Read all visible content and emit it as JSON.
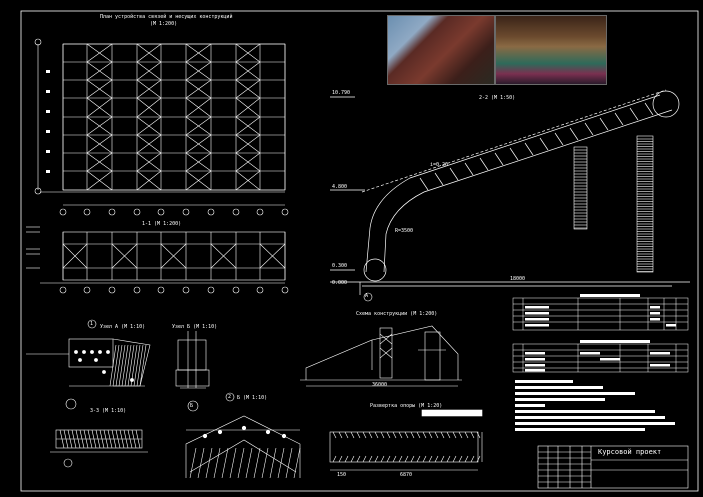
{
  "drawing": {
    "plan_title": "План устройства связей и несущих конструкций",
    "plan_scale": "(M 1:200)",
    "section_11_title": "1-1 (M 1:200)",
    "section_22_title": "2-2 (M 1:50)",
    "frame_scheme_title": "Схема конструкции (M 1:200)",
    "node_a_title": "Узел А (M 1:10)",
    "node_b_title": "Узел Б (M 1:10)",
    "section_33_title": "3-3 (M 1:10)",
    "section_b_title": "Б (M 1:10)",
    "truss_title": "Развертка опоры (M 1:20)",
    "span_dim": "18000",
    "frame_span_dim": "36000",
    "height_mark_top": "10.790",
    "height_mark_mid": "4.800",
    "height_mark_low": "0.300",
    "height_mark_zero": "0.000",
    "slope_label": "i=0.26",
    "radius_label": "R=3500",
    "dim_truss": "6870",
    "dim_truss_side": "150",
    "node_marker_a": "А",
    "node_marker_b": "Б",
    "node_marker_1": "1",
    "node_marker_2": "2",
    "stamp_text": "Курсовой проект"
  },
  "colors": {
    "background": "#000000",
    "lines": "#ffffff",
    "table_header": "#d8d8d8"
  }
}
